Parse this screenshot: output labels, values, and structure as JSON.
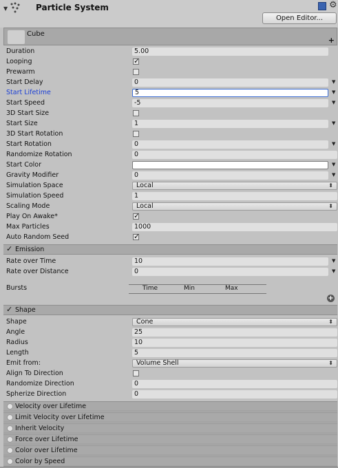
{
  "header": {
    "title": "Particle System",
    "open_editor_label": "Open Editor..."
  },
  "main_module": {
    "name": "Cube"
  },
  "main_props": [
    {
      "label": "Duration",
      "type": "text",
      "value": "5.00"
    },
    {
      "label": "Looping",
      "type": "check",
      "checked": true
    },
    {
      "label": "Prewarm",
      "type": "check",
      "checked": false
    },
    {
      "label": "Start Delay",
      "type": "text",
      "value": "0",
      "arrow": true
    },
    {
      "label": "Start Lifetime",
      "type": "text",
      "value": "5",
      "arrow": true,
      "focused": true
    },
    {
      "label": "Start Speed",
      "type": "text",
      "value": "-5",
      "arrow": true
    },
    {
      "label": "3D Start Size",
      "type": "check",
      "checked": false
    },
    {
      "label": "Start Size",
      "type": "text",
      "value": "1",
      "arrow": true
    },
    {
      "label": "3D Start Rotation",
      "type": "check",
      "checked": false
    },
    {
      "label": "Start Rotation",
      "type": "text",
      "value": "0",
      "arrow": true
    },
    {
      "label": "Randomize Rotation",
      "type": "text",
      "value": "0",
      "wide": true
    },
    {
      "label": "Start Color",
      "type": "color",
      "value": "",
      "arrow": true
    },
    {
      "label": "Gravity Modifier",
      "type": "text",
      "value": "0",
      "arrow": true
    },
    {
      "label": "Simulation Space",
      "type": "select",
      "value": "Local"
    },
    {
      "label": "Simulation Speed",
      "type": "text",
      "value": "1",
      "wide": true
    },
    {
      "label": "Scaling Mode",
      "type": "select",
      "value": "Local"
    },
    {
      "label": "Play On Awake*",
      "type": "check",
      "checked": true
    },
    {
      "label": "Max Particles",
      "type": "text",
      "value": "1000",
      "wide": true
    },
    {
      "label": "Auto Random Seed",
      "type": "check",
      "checked": true
    }
  ],
  "emission": {
    "title": "Emission",
    "props": [
      {
        "label": "Rate over Time",
        "type": "text",
        "value": "10",
        "arrow": true
      },
      {
        "label": "Rate over Distance",
        "type": "text",
        "value": "0",
        "arrow": true
      }
    ],
    "bursts_label": "Bursts",
    "bursts_cols": [
      "Time",
      "Min",
      "Max"
    ]
  },
  "shape": {
    "title": "Shape",
    "props": [
      {
        "label": "Shape",
        "type": "select",
        "value": "Cone"
      },
      {
        "label": "Angle",
        "type": "text",
        "value": "25",
        "wide": true
      },
      {
        "label": "Radius",
        "type": "text",
        "value": "10",
        "wide": true
      },
      {
        "label": "Length",
        "type": "text",
        "value": "5",
        "wide": true
      },
      {
        "label": "Emit from:",
        "type": "select",
        "value": "Volume Shell"
      },
      {
        "label": "Align To Direction",
        "type": "check",
        "checked": false
      },
      {
        "label": "Randomize Direction",
        "type": "text",
        "value": "0",
        "wide": true
      },
      {
        "label": "Spherize Direction",
        "type": "text",
        "value": "0",
        "wide": true
      }
    ]
  },
  "collapsed_modules": [
    "Velocity over Lifetime",
    "Limit Velocity over Lifetime",
    "Inherit Velocity",
    "Force over Lifetime",
    "Color over Lifetime",
    "Color by Speed"
  ]
}
